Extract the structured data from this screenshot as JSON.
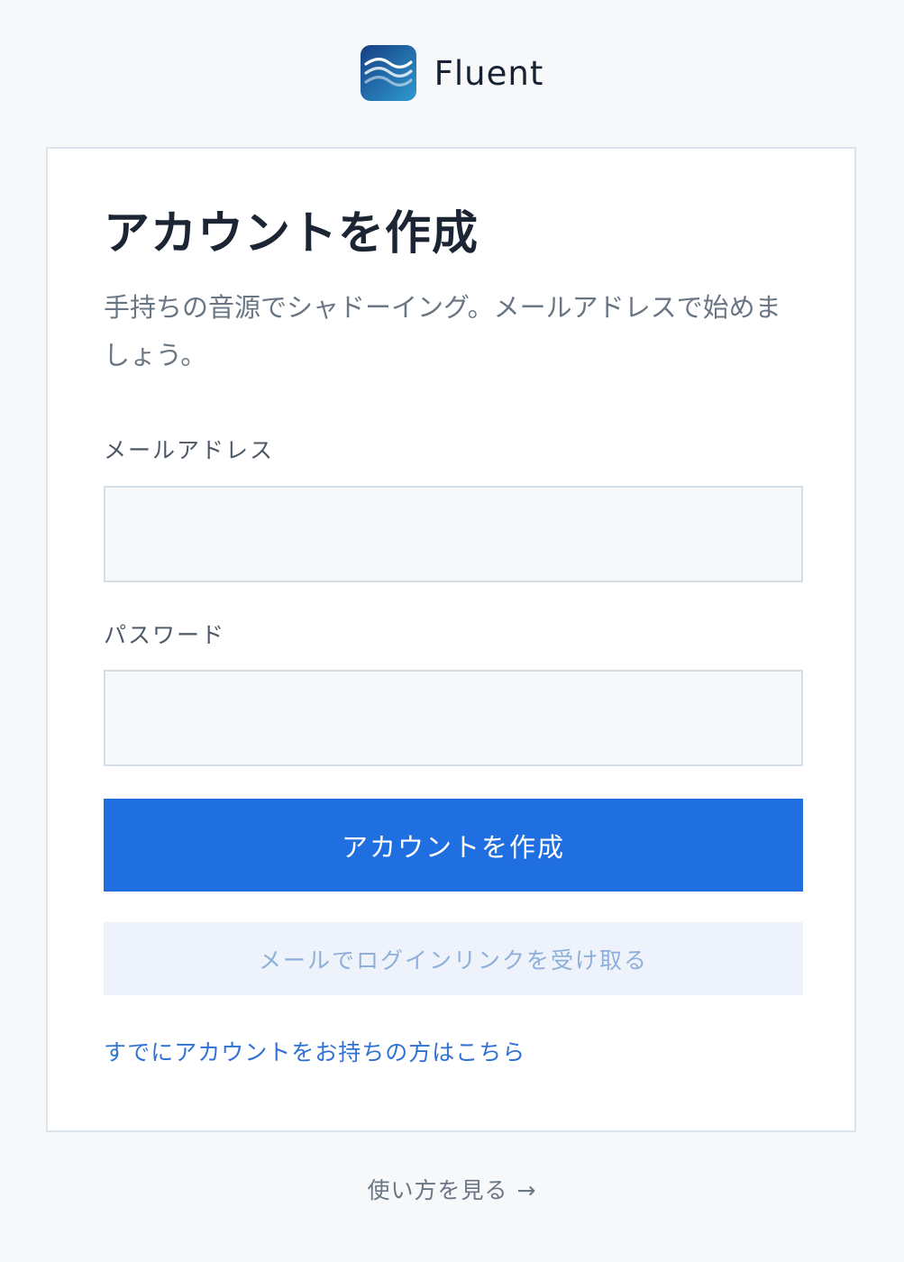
{
  "brand": {
    "name": "Fluent",
    "logo_icon": "wave-icon",
    "logo_gradient": [
      "#163f84",
      "#2f9ad0"
    ]
  },
  "signup": {
    "title": "アカウントを作成",
    "subtitle": "手持ちの音源でシャドーイング。メールアドレスで始めましょう。",
    "email": {
      "label": "メールアドレス",
      "value": ""
    },
    "password": {
      "label": "パスワード",
      "value": ""
    },
    "submit_label": "アカウントを作成",
    "magic_link_label": "メールでログインリンクを受け取る",
    "login_link_label": "すでにアカウントをお持ちの方はこちら"
  },
  "footer": {
    "howto_label": "使い方を見る",
    "howto_arrow": "→"
  },
  "colors": {
    "page_bg": "#f6f8fa",
    "primary": "#1f6fe0",
    "secondary_bg": "#eef3fb",
    "link": "#2f72d3"
  }
}
